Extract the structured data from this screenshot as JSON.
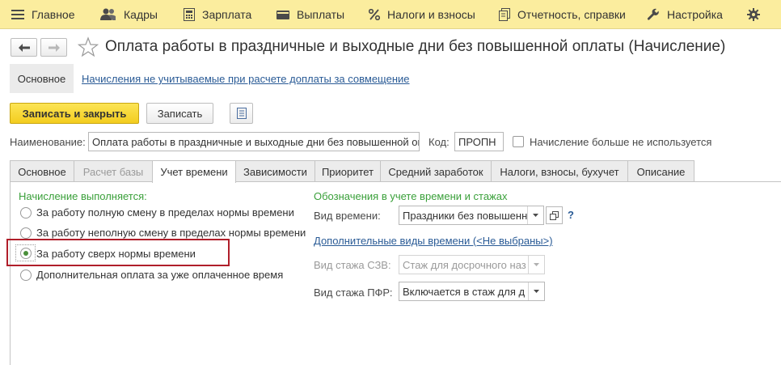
{
  "menu": {
    "items": [
      {
        "label": "Главное",
        "icon": "hamburger-icon"
      },
      {
        "label": "Кадры",
        "icon": "people-icon"
      },
      {
        "label": "Зарплата",
        "icon": "calculator-icon"
      },
      {
        "label": "Выплаты",
        "icon": "wallet-icon"
      },
      {
        "label": "Налоги и взносы",
        "icon": "percent-icon"
      },
      {
        "label": "Отчетность, справки",
        "icon": "reports-icon"
      },
      {
        "label": "Настройка",
        "icon": "wrench-icon"
      },
      {
        "label": "",
        "icon": "gear-icon"
      }
    ]
  },
  "header": {
    "title": "Оплата работы в праздничные и выходные дни без повышенной оплаты (Начисление)"
  },
  "sections": {
    "active": "Основное",
    "link": "Начисления не учитываемые при расчете доплаты за совмещение"
  },
  "toolbar": {
    "save_close_label": "Записать и закрыть",
    "save_label": "Записать",
    "report_icon": "list-report-icon"
  },
  "form": {
    "name_label": "Наименование:",
    "name_value": "Оплата работы в праздничные и выходные дни без повышенной оп",
    "code_label": "Код:",
    "code_value": "ПРОПН",
    "unused_label": "Начисление больше не используется",
    "unused_checked": false
  },
  "tabs": [
    {
      "label": "Основное",
      "state": "normal"
    },
    {
      "label": "Расчет базы",
      "state": "disabled"
    },
    {
      "label": "Учет времени",
      "state": "active"
    },
    {
      "label": "Зависимости",
      "state": "normal"
    },
    {
      "label": "Приоритет",
      "state": "normal"
    },
    {
      "label": "Средний заработок",
      "state": "normal"
    },
    {
      "label": "Налоги, взносы, бухучет",
      "state": "normal"
    },
    {
      "label": "Описание",
      "state": "normal"
    }
  ],
  "accrual": {
    "title": "Начисление выполняется:",
    "options": [
      {
        "label": "За работу полную смену в пределах нормы времени",
        "checked": false
      },
      {
        "label": "За работу неполную смену в пределах нормы времени",
        "checked": false
      },
      {
        "label": "За работу сверх нормы времени",
        "checked": true
      },
      {
        "label": "Дополнительная оплата за уже оплаченное время",
        "checked": false
      }
    ],
    "highlight_color": "#b01e2a"
  },
  "time": {
    "title": "Обозначения в учете времени и стажах",
    "vid_label": "Вид времени:",
    "vid_value": "Праздники без повышенн",
    "help": "?",
    "extra_link": "Дополнительные виды времени (<Не выбраны>)",
    "szv_label": "Вид стажа СЗВ:",
    "szv_value": "Стаж для досрочного наз",
    "pfr_label": "Вид стажа ПФР:",
    "pfr_value": "Включается в стаж для д"
  },
  "colors": {
    "topbar": "#fbed9e",
    "primary_button": "#f3cd1f",
    "link": "#2a5b96",
    "group_title": "#3aa03a"
  }
}
